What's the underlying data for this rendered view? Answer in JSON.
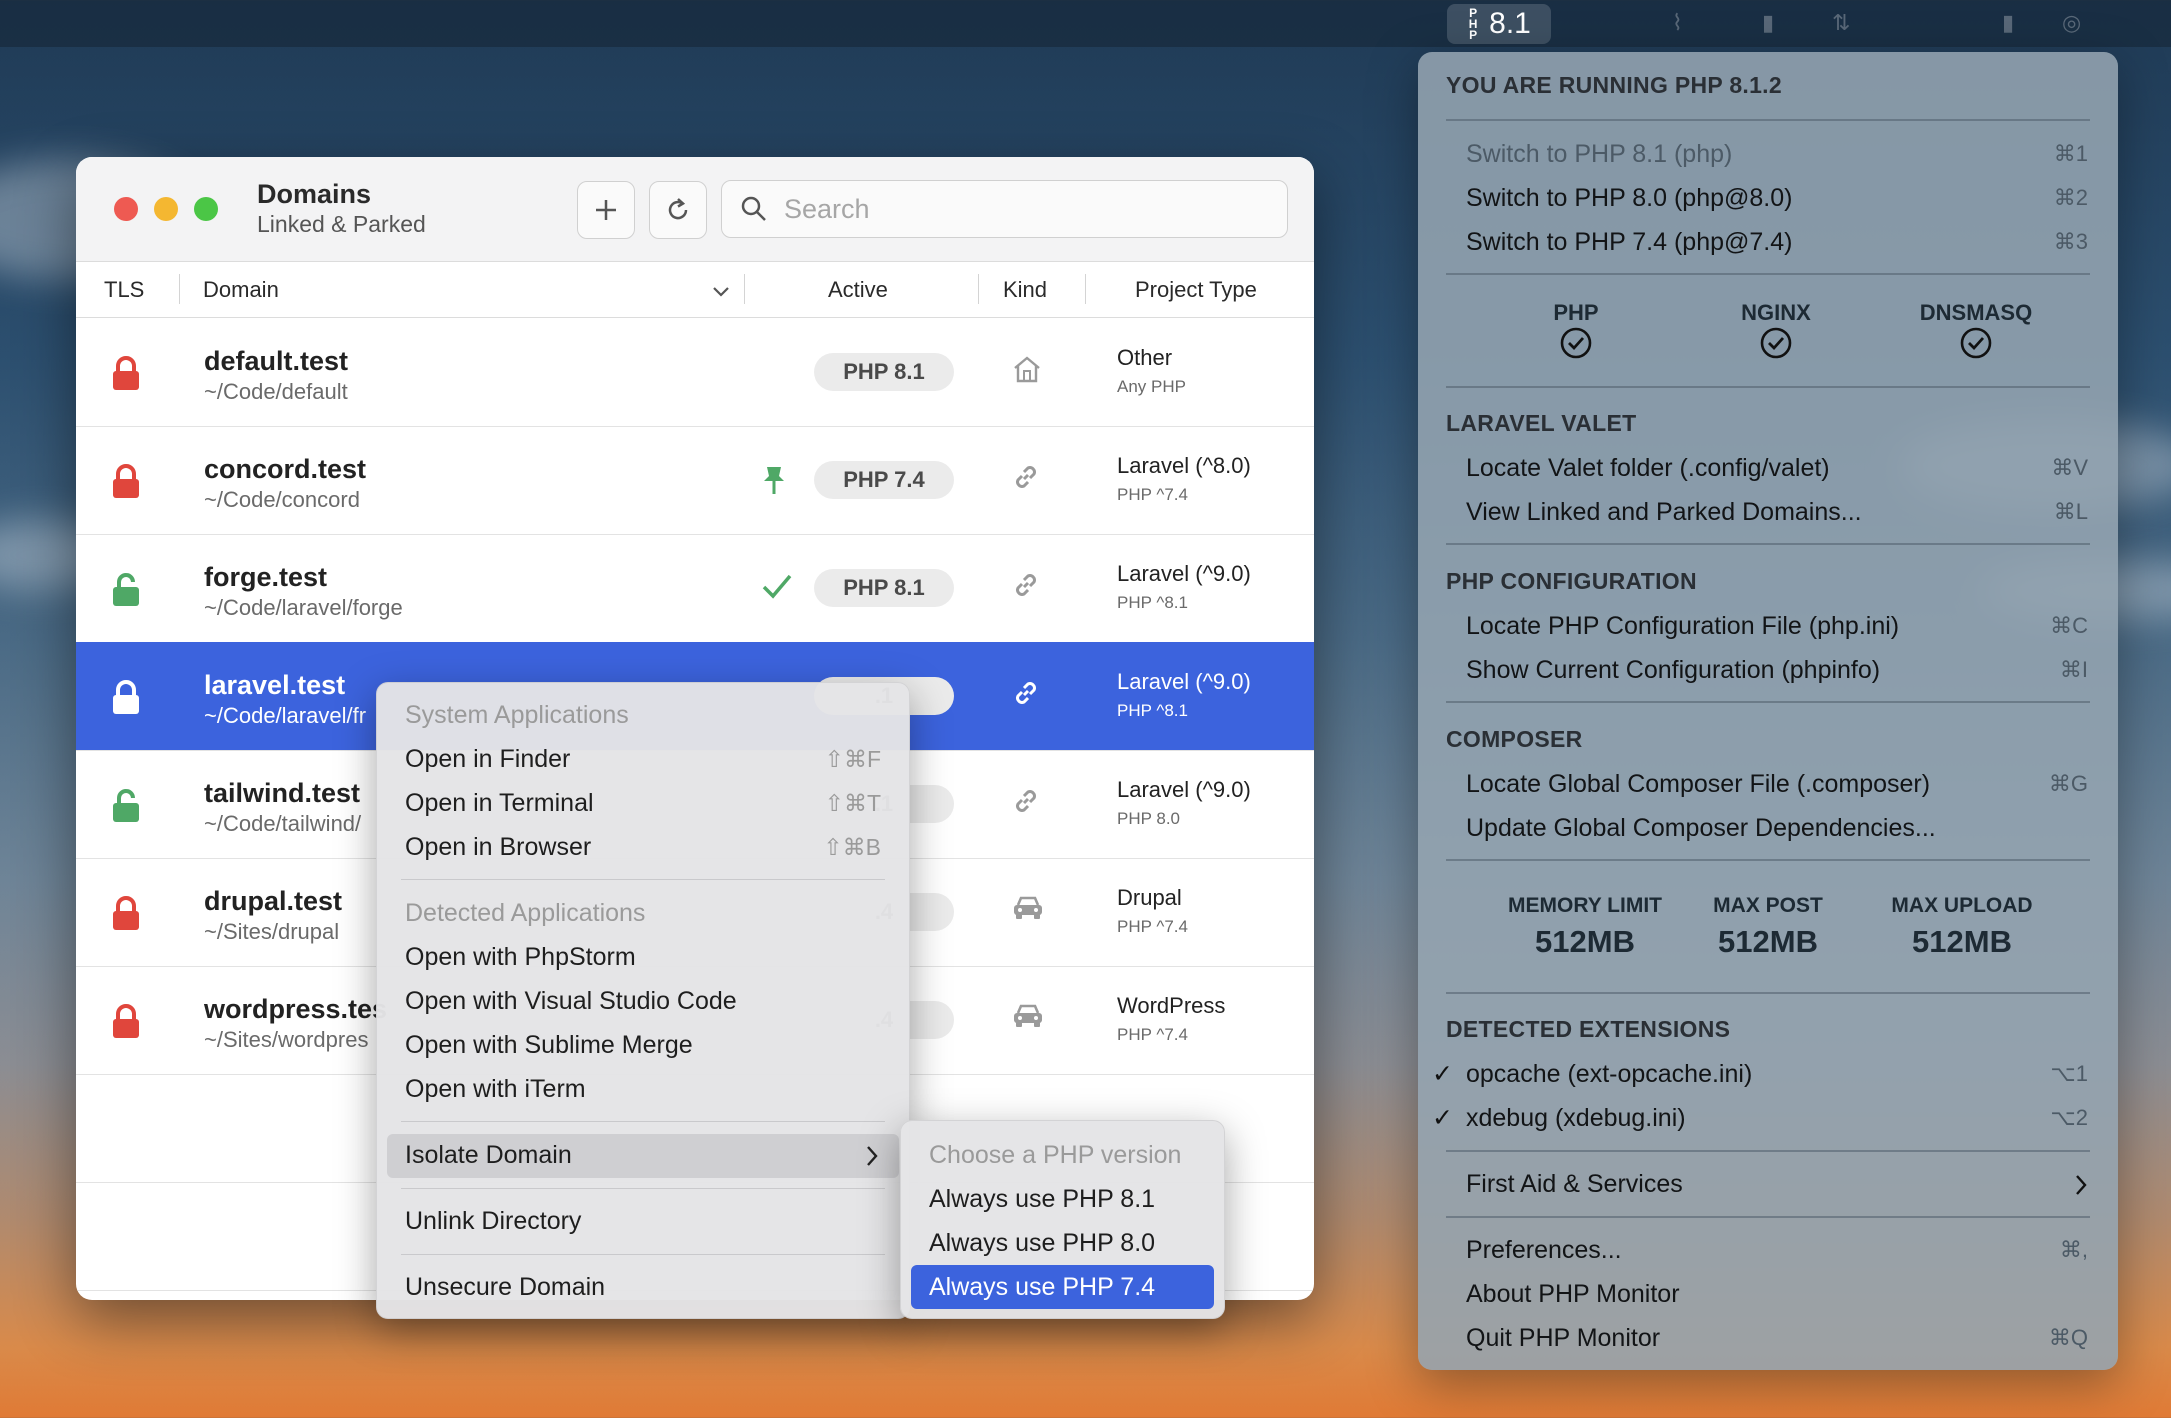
{
  "menubar": {
    "php_version": "8.1"
  },
  "window": {
    "title": "Domains",
    "subtitle": "Linked & Parked",
    "search_placeholder": "Search",
    "columns": {
      "tls": "TLS",
      "domain": "Domain",
      "active": "Active",
      "kind": "Kind",
      "project_type": "Project Type"
    },
    "rows": [
      {
        "name": "default.test",
        "path": "~/Code/default",
        "secure": true,
        "status": "",
        "php": "PHP 8.1",
        "kind": "parked",
        "type": "Other",
        "constraint": "Any PHP"
      },
      {
        "name": "concord.test",
        "path": "~/Code/concord",
        "secure": true,
        "status": "isolated",
        "php": "PHP 7.4",
        "kind": "linked",
        "type": "Laravel (^8.0)",
        "constraint": "PHP ^7.4"
      },
      {
        "name": "forge.test",
        "path": "~/Code/laravel/forge",
        "secure": false,
        "status": "compatible",
        "php": "PHP 8.1",
        "kind": "linked",
        "type": "Laravel (^9.0)",
        "constraint": "PHP ^8.1"
      },
      {
        "name": "laravel.test",
        "path": "~/Code/laravel/fr",
        "secure": true,
        "status": "",
        "php": ".1",
        "kind": "linked",
        "type": "Laravel (^9.0)",
        "constraint": "PHP ^8.1",
        "selected": true
      },
      {
        "name": "tailwind.test",
        "path": "~/Code/tailwind/",
        "secure": false,
        "status": "",
        "php": ".1",
        "kind": "linked",
        "type": "Laravel (^9.0)",
        "constraint": "PHP 8.0"
      },
      {
        "name": "drupal.test",
        "path": "~/Sites/drupal",
        "secure": true,
        "status": "",
        "php": ".4",
        "kind": "car",
        "type": "Drupal",
        "constraint": "PHP ^7.4"
      },
      {
        "name": "wordpress.tes",
        "path": "~/Sites/wordpres",
        "secure": true,
        "status": "",
        "php": ".4",
        "kind": "car",
        "type": "WordPress",
        "constraint": "PHP ^7.4"
      }
    ]
  },
  "context_menu": {
    "system_header": "System Applications",
    "system": [
      {
        "label": "Open in Finder",
        "shortcut": "⇧⌘F"
      },
      {
        "label": "Open in Terminal",
        "shortcut": "⇧⌘T"
      },
      {
        "label": "Open in Browser",
        "shortcut": "⇧⌘B"
      }
    ],
    "detected_header": "Detected Applications",
    "detected": [
      "Open with PhpStorm",
      "Open with Visual Studio Code",
      "Open with Sublime Merge",
      "Open with iTerm"
    ],
    "isolate": "Isolate Domain",
    "unlink": "Unlink Directory",
    "unsecure": "Unsecure Domain"
  },
  "submenu": {
    "header": "Choose a PHP version",
    "items": [
      "Always use PHP 8.1",
      "Always use PHP 8.0",
      "Always use PHP 7.4"
    ]
  },
  "panel": {
    "header": "YOU ARE RUNNING PHP 8.1.2",
    "switch": [
      {
        "label": "Switch to PHP 8.1 (php)",
        "shortcut": "⌘1",
        "disabled": true
      },
      {
        "label": "Switch to PHP 8.0 (php@8.0)",
        "shortcut": "⌘2"
      },
      {
        "label": "Switch to PHP 7.4 (php@7.4)",
        "shortcut": "⌘3"
      }
    ],
    "services": [
      "PHP",
      "NGINX",
      "DNSMASQ"
    ],
    "valet_header": "LARAVEL VALET",
    "valet": [
      {
        "label": "Locate Valet folder (.config/valet)",
        "shortcut": "⌘V"
      },
      {
        "label": "View Linked and Parked Domains...",
        "shortcut": "⌘L"
      }
    ],
    "config_header": "PHP CONFIGURATION",
    "config": [
      {
        "label": "Locate PHP Configuration File (php.ini)",
        "shortcut": "⌘C"
      },
      {
        "label": "Show Current Configuration (phpinfo)",
        "shortcut": "⌘I"
      }
    ],
    "composer_header": "COMPOSER",
    "composer": [
      {
        "label": "Locate Global Composer File (.composer)",
        "shortcut": "⌘G"
      },
      {
        "label": "Update Global Composer Dependencies...",
        "shortcut": ""
      }
    ],
    "limits": [
      {
        "label": "MEMORY LIMIT",
        "value": "512MB"
      },
      {
        "label": "MAX POST",
        "value": "512MB"
      },
      {
        "label": "MAX UPLOAD",
        "value": "512MB"
      }
    ],
    "ext_header": "DETECTED EXTENSIONS",
    "extensions": [
      {
        "label": "opcache (ext-opcache.ini)",
        "shortcut": "⌥1",
        "enabled": true
      },
      {
        "label": "xdebug (xdebug.ini)",
        "shortcut": "⌥2",
        "enabled": true
      }
    ],
    "first_aid": "First Aid & Services",
    "preferences": {
      "label": "Preferences...",
      "shortcut": "⌘,"
    },
    "about": "About PHP Monitor",
    "quit": {
      "label": "Quit PHP Monitor",
      "shortcut": "⌘Q"
    }
  },
  "colors": {
    "selection": "#3c63dd",
    "lock_red": "#e0463c",
    "lock_green": "#4fa866"
  }
}
